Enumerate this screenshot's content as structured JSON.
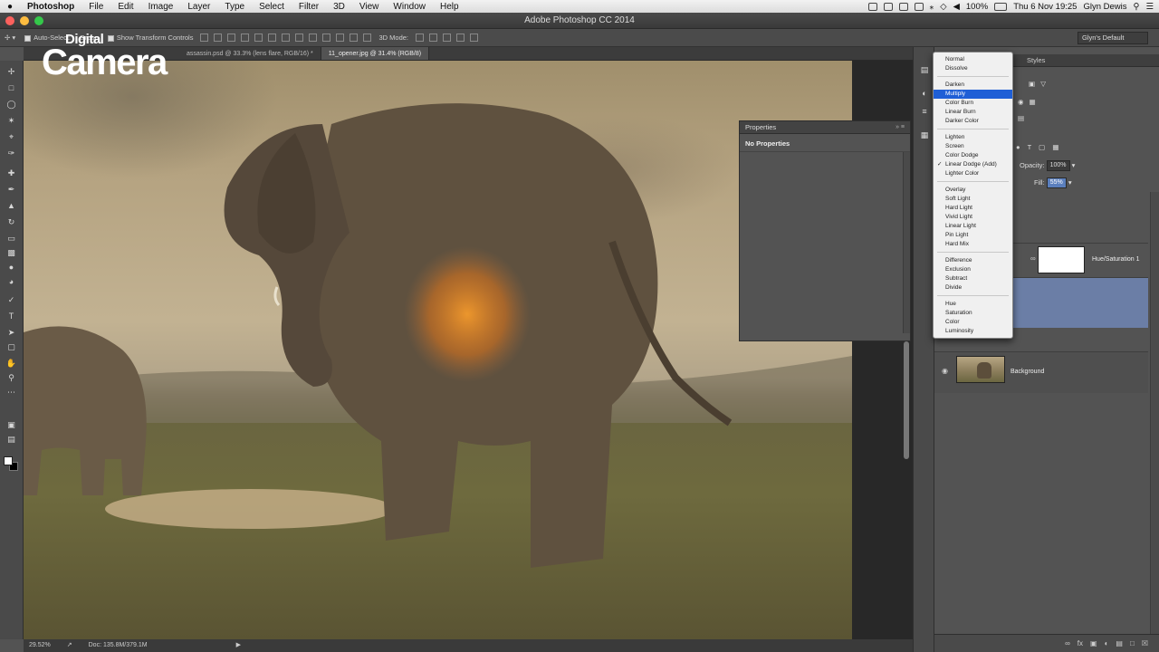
{
  "menubar": {
    "apple": "",
    "items": [
      "Photoshop",
      "File",
      "Edit",
      "Image",
      "Layer",
      "Type",
      "Select",
      "Filter",
      "3D",
      "View",
      "Window",
      "Help"
    ],
    "battery": "100%",
    "datetime": "Thu 6 Nov  19:25",
    "user": "Glyn Dewis"
  },
  "window": {
    "title": "Adobe Photoshop CC 2014"
  },
  "options": {
    "auto_select": "Auto-Select:",
    "auto_select_value": "Group",
    "show_transform": "Show Transform Controls",
    "mode_3d": "3D Mode:",
    "workspace": "Glyn's Default"
  },
  "tabs": [
    {
      "label": "assassin.psd @ 33.3% (lens flare, RGB/16) *"
    },
    {
      "label": "11_opener.jpg @ 31.4% (RGB/8)"
    }
  ],
  "brand": {
    "digital": "Digital",
    "camera": "Camera"
  },
  "status": {
    "zoom": "29.52%",
    "doc": "Doc: 135.8M/379.1M"
  },
  "properties": {
    "title": "Properties",
    "body": "No Properties"
  },
  "right_panel": {
    "tab_styles": "Styles",
    "opacity_label": "Opacity:",
    "opacity_value": "100%",
    "fill_label": "Fill:",
    "fill_value": "55%",
    "layers": [
      {
        "name": "Hue/Saturation 1"
      },
      {
        "name": "Background"
      }
    ]
  },
  "blend_modes": {
    "groups": [
      [
        "Normal",
        "Dissolve"
      ],
      [
        "Darken",
        "Multiply",
        "Color Burn",
        "Linear Burn",
        "Darker Color"
      ],
      [
        "Lighten",
        "Screen",
        "Color Dodge",
        "Linear Dodge (Add)",
        "Lighter Color"
      ],
      [
        "Overlay",
        "Soft Light",
        "Hard Light",
        "Vivid Light",
        "Linear Light",
        "Pin Light",
        "Hard Mix"
      ],
      [
        "Difference",
        "Exclusion",
        "Subtract",
        "Divide"
      ],
      [
        "Hue",
        "Saturation",
        "Color",
        "Luminosity"
      ]
    ],
    "highlighted": "Multiply",
    "checked": "Linear Dodge (Add)"
  }
}
